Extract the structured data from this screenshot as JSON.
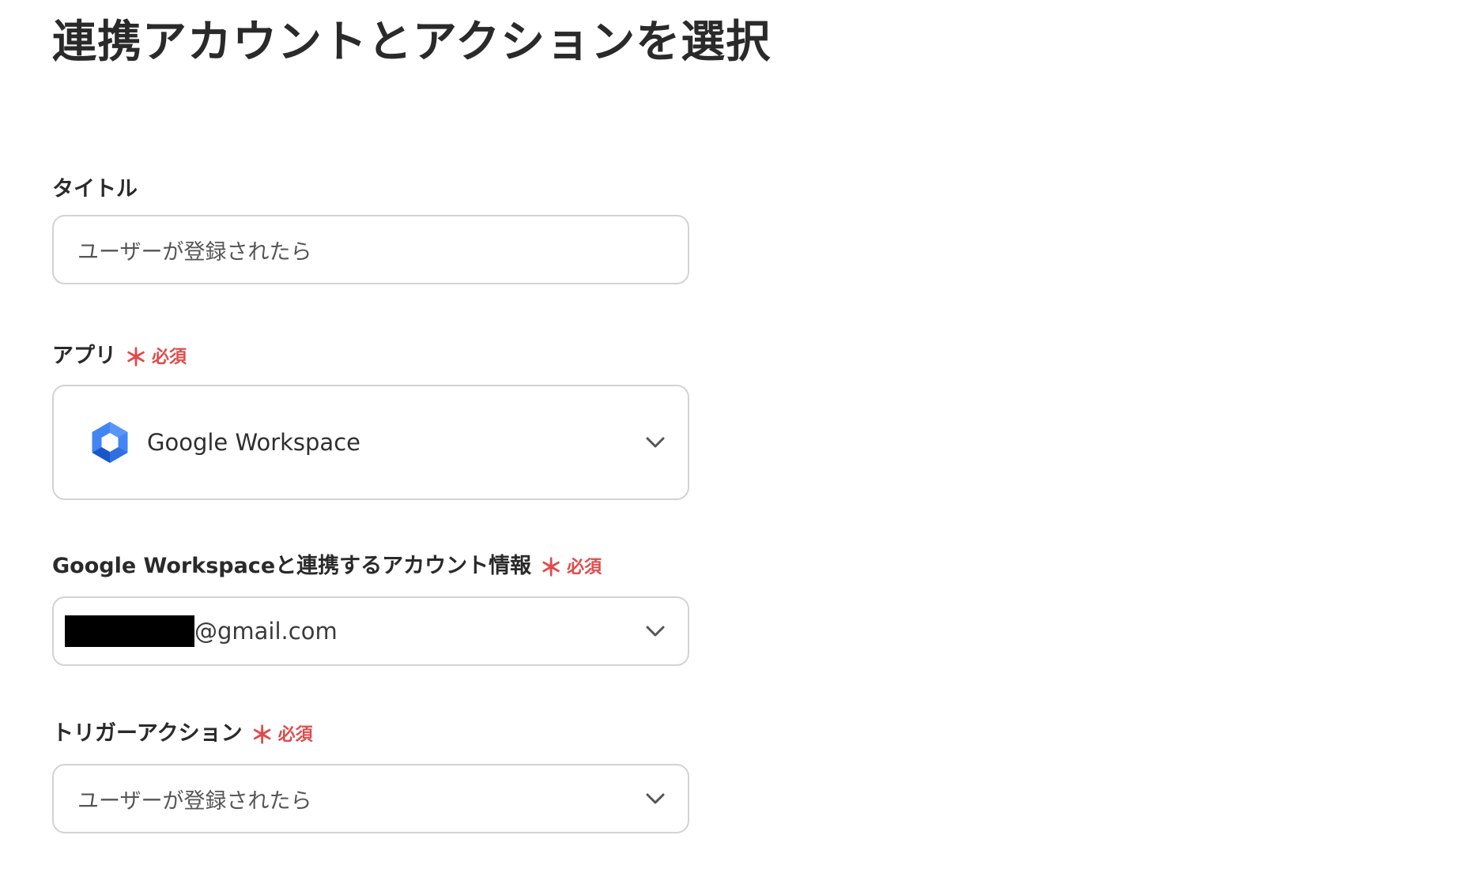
{
  "page": {
    "title": "連携アカウントとアクションを選択"
  },
  "fields": {
    "title": {
      "label": "タイトル",
      "value": "ユーザーが登録されたら"
    },
    "app": {
      "label": "アプリ",
      "required_mark": "＊",
      "required_text": "必須",
      "selected_app": "Google Workspace",
      "icon": "google-workspace-logo"
    },
    "account": {
      "label": "Google Workspaceと連携するアカウント情報",
      "required_mark": "＊",
      "required_text": "必須",
      "email_suffix": "@gmail.com"
    },
    "trigger": {
      "label": "トリガーアクション",
      "required_mark": "＊",
      "required_text": "必須",
      "selected_value": "ユーザーが登録されたら"
    }
  },
  "colors": {
    "required": "#e04b4b",
    "border": "#d3d3d3",
    "logo_blue": "#4285f4",
    "logo_dark_blue": "#1a56c9"
  }
}
